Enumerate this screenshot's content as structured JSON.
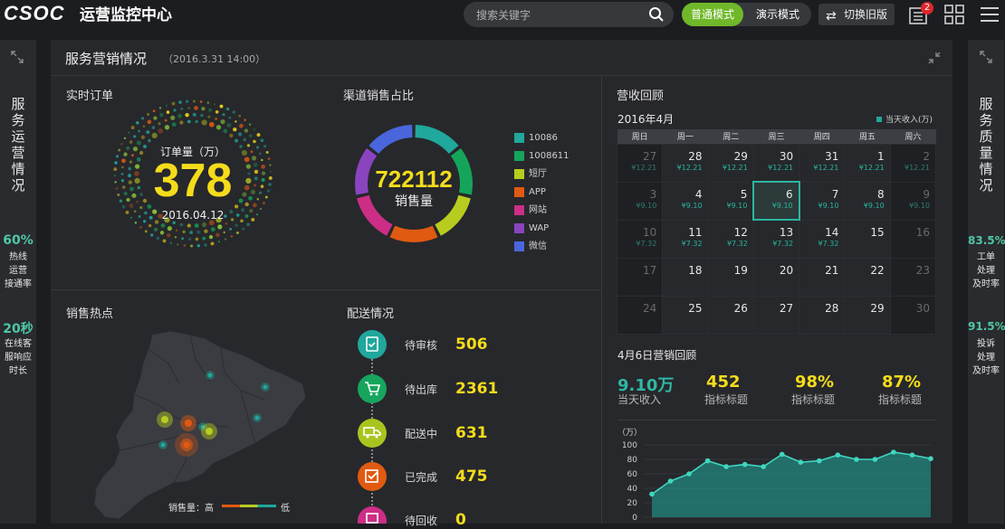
{
  "header": {
    "logo": "CSOC",
    "title": "运营监控中心",
    "search_placeholder": "搜索关键字",
    "mode_normal": "普通模式",
    "mode_demo": "演示模式",
    "old_version": "切换旧版",
    "notif_count": "2"
  },
  "left_panel": {
    "title": [
      "服",
      "务",
      "运",
      "营",
      "情",
      "况"
    ],
    "metrics": [
      {
        "value": "60%",
        "label": [
          "热线",
          "运营",
          "接通率"
        ]
      },
      {
        "value": "20秒",
        "label": [
          "在线客",
          "服响应",
          "时长"
        ]
      }
    ]
  },
  "right_panel": {
    "title": [
      "服",
      "务",
      "质",
      "量",
      "情",
      "况"
    ],
    "metrics": [
      {
        "value": "83.5%",
        "label": [
          "工单",
          "处理",
          "及时率"
        ]
      },
      {
        "value": "91.5%",
        "label": [
          "投诉",
          "处理",
          "及时率"
        ]
      }
    ]
  },
  "main": {
    "title": "服务营销情况",
    "datetime": "（2016.3.31 14:00）"
  },
  "orders": {
    "title": "实时订单",
    "label": "订单量（万）",
    "value": "378",
    "date": "2016.04.12"
  },
  "channel": {
    "title": "渠道销售占比",
    "value": "722112",
    "label": "销售量",
    "legend": [
      {
        "name": "10086",
        "color": "#1fa89b"
      },
      {
        "name": "1008611",
        "color": "#14a55a"
      },
      {
        "name": "短厅",
        "color": "#b8cc1f"
      },
      {
        "name": "APP",
        "color": "#e05a12"
      },
      {
        "name": "网站",
        "color": "#cc2e86"
      },
      {
        "name": "WAP",
        "color": "#8a44c0"
      },
      {
        "name": "微信",
        "color": "#4a66dd"
      }
    ]
  },
  "hotspot": {
    "title": "销售热点",
    "legend_high": "销售量：高",
    "legend_low": "低"
  },
  "delivery": {
    "title": "配送情况",
    "steps": [
      {
        "label": "待审核",
        "value": "506",
        "color": "#1fa89b",
        "icon": "clipboard-check-icon"
      },
      {
        "label": "待出库",
        "value": "2361",
        "color": "#17a55e",
        "icon": "cart-icon"
      },
      {
        "label": "配送中",
        "value": "631",
        "color": "#a8c41e",
        "icon": "truck-icon"
      },
      {
        "label": "已完成",
        "value": "475",
        "color": "#e05a12",
        "icon": "check-box-icon"
      },
      {
        "label": "待回收",
        "value": "0",
        "color": "#cc2e86",
        "icon": "recycle-icon"
      }
    ]
  },
  "revenue": {
    "title": "营收回顾",
    "month": "2016年4月",
    "today_legend": "当天收入(万)",
    "weekdays": [
      "周日",
      "周一",
      "周二",
      "周三",
      "周四",
      "周五",
      "周六"
    ],
    "weeks": [
      [
        {
          "d": "27",
          "v": "¥12.21",
          "dim": true
        },
        {
          "d": "28",
          "v": "¥12.21"
        },
        {
          "d": "29",
          "v": "¥12.21"
        },
        {
          "d": "30",
          "v": "¥12.21"
        },
        {
          "d": "31",
          "v": "¥12.21"
        },
        {
          "d": "1",
          "v": "¥12.21"
        },
        {
          "d": "2",
          "v": "¥12.21",
          "dim": true
        }
      ],
      [
        {
          "d": "3",
          "v": "¥9.10",
          "dim": true
        },
        {
          "d": "4",
          "v": "¥9.10"
        },
        {
          "d": "5",
          "v": "¥9.10"
        },
        {
          "d": "6",
          "v": "¥9.10",
          "today": true
        },
        {
          "d": "7",
          "v": "¥9.10"
        },
        {
          "d": "8",
          "v": "¥9.10"
        },
        {
          "d": "9",
          "v": "¥9.10",
          "dim": true
        }
      ],
      [
        {
          "d": "10",
          "v": "¥7.32",
          "dim": true
        },
        {
          "d": "11",
          "v": "¥7.32"
        },
        {
          "d": "12",
          "v": "¥7.32"
        },
        {
          "d": "13",
          "v": "¥7.32"
        },
        {
          "d": "14",
          "v": "¥7.32"
        },
        {
          "d": "15",
          "v": ""
        },
        {
          "d": "16",
          "v": "",
          "dim": true
        }
      ],
      [
        {
          "d": "17",
          "v": "",
          "dim": true
        },
        {
          "d": "18",
          "v": ""
        },
        {
          "d": "19",
          "v": ""
        },
        {
          "d": "20",
          "v": ""
        },
        {
          "d": "21",
          "v": ""
        },
        {
          "d": "22",
          "v": ""
        },
        {
          "d": "23",
          "v": "",
          "dim": true
        }
      ],
      [
        {
          "d": "24",
          "v": "",
          "dim": true
        },
        {
          "d": "25",
          "v": ""
        },
        {
          "d": "26",
          "v": ""
        },
        {
          "d": "27",
          "v": ""
        },
        {
          "d": "28",
          "v": ""
        },
        {
          "d": "29",
          "v": ""
        },
        {
          "d": "30",
          "v": "",
          "dim": true
        }
      ]
    ],
    "review_title": "4月6日营销回顾",
    "kpis": [
      {
        "value": "9.10万",
        "label": "当天收入",
        "teal": true
      },
      {
        "value": "452",
        "label": "指标标题"
      },
      {
        "value": "98%",
        "label": "指标标题"
      },
      {
        "value": "87%",
        "label": "指标标题"
      }
    ]
  },
  "chart_data": {
    "type": "area",
    "ylabel": "（万）",
    "ylim": [
      0,
      100
    ],
    "yticks": [
      "100",
      "80",
      "60",
      "40",
      "20",
      "0"
    ],
    "values": [
      32,
      50,
      60,
      78,
      70,
      73,
      70,
      87,
      76,
      78,
      86,
      80,
      80,
      90,
      86,
      81
    ],
    "color": "#1fa89b"
  }
}
